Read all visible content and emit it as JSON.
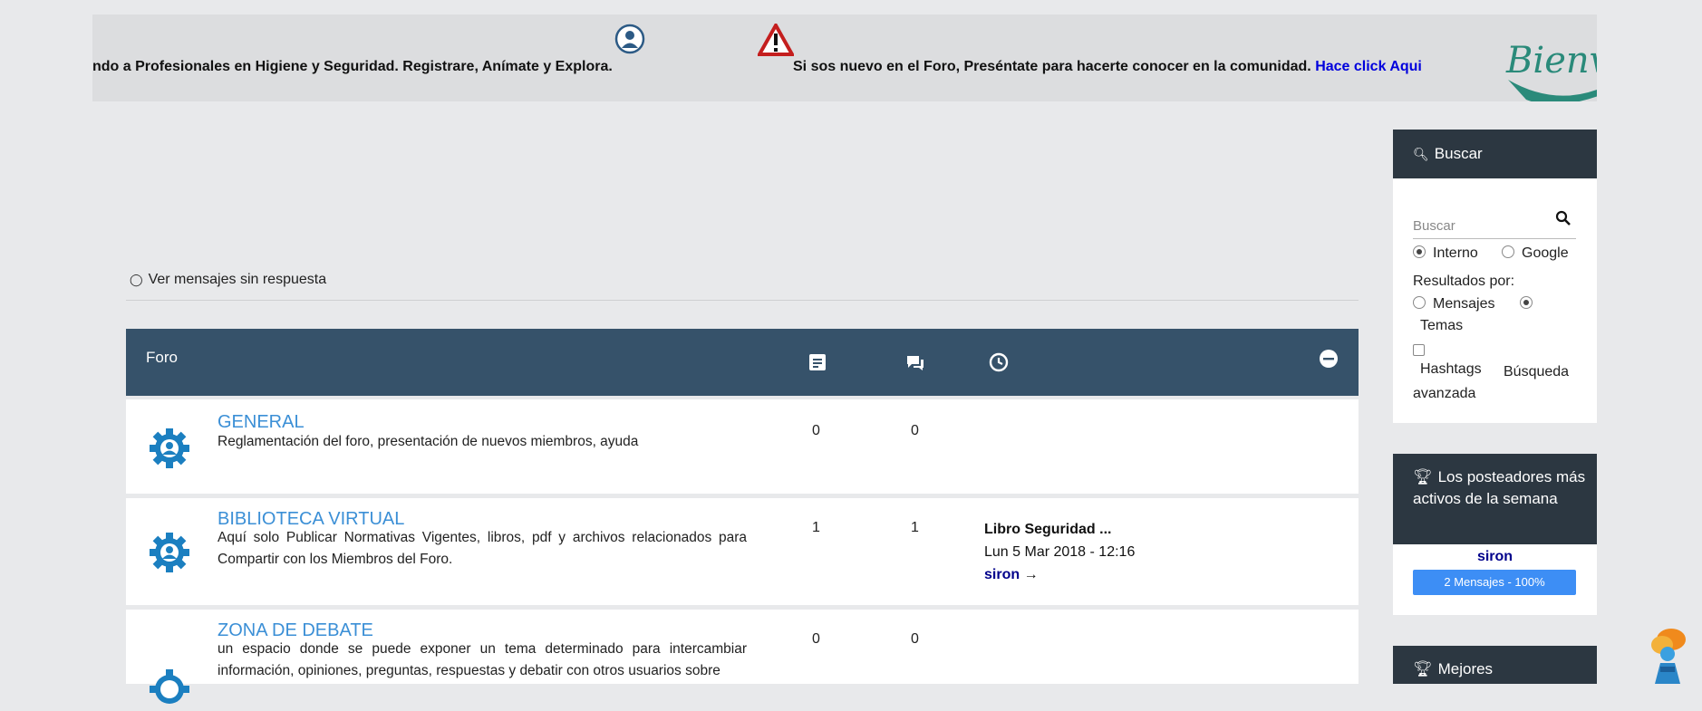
{
  "banner": {
    "text_1": "ndo a Profesionales en Higiene y Seguridad. Registrare, Anímate y Explora.",
    "text_2": "Si sos nuevo en el Foro, Preséntate para hacerte conocer en la comunidad.",
    "link": "Hace click Aqui",
    "logo_text": "Bienve"
  },
  "unanswered": {
    "icon": "speech-bubble-icon",
    "label": "Ver mensajes sin respuesta"
  },
  "forum": {
    "header_title": "Foro",
    "header_icons": [
      "posts-icon",
      "topics-icon",
      "clock-icon",
      "collapse-icon"
    ],
    "rows": [
      {
        "name": "GENERAL",
        "desc": "Reglamentación del foro, presentación de nuevos miembros, ayuda",
        "posts": "0",
        "topics": "0"
      },
      {
        "name": "BIBLIOTECA VIRTUAL",
        "desc": "Aquí solo Publicar Normativas Vigentes, libros, pdf y archivos relacionados para Compartir con los Miembros del Foro.",
        "posts": "1",
        "topics": "1",
        "last_title": "Libro Seguridad ...",
        "last_date": "Lun 5 Mar 2018 - 12:16",
        "last_user": "siron",
        "last_arrow": "→"
      },
      {
        "name": "ZONA DE DEBATE",
        "desc": "un espacio donde se puede exponer un tema determinado para intercambiar información, opiniones, preguntas, respuestas y debatir con otros usuarios sobre",
        "posts": "0",
        "topics": "0"
      }
    ]
  },
  "sidebar": {
    "search": {
      "title": "Buscar",
      "placeholder": "Buscar",
      "opt_internal": "Interno",
      "opt_google": "Google",
      "results_by": "Resultados por:",
      "opt_posts": "Mensajes",
      "opt_topics": "Temas",
      "hashtags": "Hashtags",
      "advanced": "Búsqueda avanzada"
    },
    "top_posters": {
      "title": "Los posteadores más activos de la semana",
      "user": "siron",
      "bar_label": "2 Mensajes - 100%",
      "bar_fraction": 1.0
    },
    "best": {
      "title": "Mejores"
    }
  },
  "colors": {
    "forum_header": "#36526a",
    "panel_header": "#2c3741",
    "link_blue": "#3b8fd6",
    "bar_blue": "#3d8ef5"
  }
}
